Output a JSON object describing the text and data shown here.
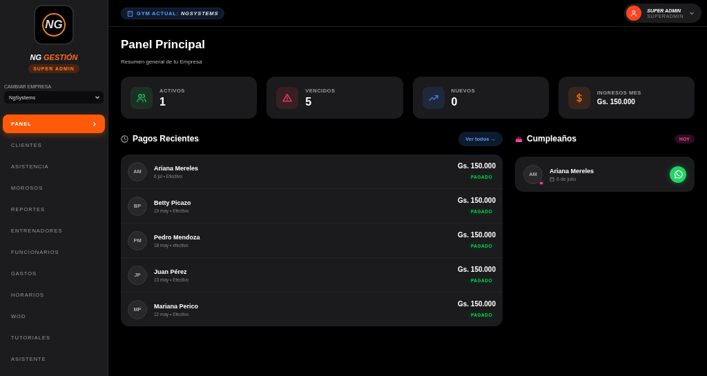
{
  "sidebar": {
    "logo_text": "NG",
    "brand": {
      "first": "NG",
      "second": "GESTIÓN"
    },
    "role_badge": "SUPER ADMIN",
    "company_label": "CAMBIAR EMPRESA",
    "company_value": "NgSystems",
    "items": [
      {
        "label": "PANEL",
        "selected": true
      },
      {
        "label": "CLIENTES",
        "selected": false
      },
      {
        "label": "ASISTENCIA",
        "selected": false
      },
      {
        "label": "MOROSOS",
        "selected": false
      },
      {
        "label": "REPORTES",
        "selected": false
      },
      {
        "label": "ENTRENADORES",
        "selected": false
      },
      {
        "label": "FUNCIONARIOS",
        "selected": false
      },
      {
        "label": "GASTOS",
        "selected": false
      },
      {
        "label": "HORARIOS",
        "selected": false
      },
      {
        "label": "WOD",
        "selected": false
      },
      {
        "label": "TUTORIALES",
        "selected": false
      },
      {
        "label": "ASISTENTE",
        "selected": false
      }
    ]
  },
  "topbar": {
    "gym_label": "GYM ACTUAL:",
    "gym_name": "NGSYSTEMS",
    "user_name": "SUPER ADMIN",
    "user_role": "SUPERADMIN"
  },
  "page": {
    "title": "Panel Principal",
    "subtitle": "Resumen general de tu Empresa"
  },
  "stats": [
    {
      "kind": "users",
      "label": "ACTIVOS",
      "value": "1",
      "color": "#22c55e"
    },
    {
      "kind": "alert",
      "label": "VENCIDOS",
      "value": "5",
      "color": "#f43f5e"
    },
    {
      "kind": "trend",
      "label": "NUEVOS",
      "value": "0",
      "color": "#3b82f6"
    },
    {
      "kind": "dollar",
      "label": "INGRESOS MES",
      "value": "Gs. 150.000",
      "color": "#f97316"
    }
  ],
  "payments": {
    "title": "Pagos Recientes",
    "link": "Ver todos →",
    "rows": [
      {
        "initials": "AM",
        "name": "Ariana Mereles",
        "meta": "6 jul • Efectivo",
        "amount": "Gs. 150.000",
        "status": "PAGADO"
      },
      {
        "initials": "BP",
        "name": "Betty Picazo",
        "meta": "19 may • Efectivo",
        "amount": "Gs. 150.000",
        "status": "PAGADO"
      },
      {
        "initials": "PM",
        "name": "Pedro Mendoza",
        "meta": "18 may • efectivo",
        "amount": "Gs. 150.000",
        "status": "PAGADO"
      },
      {
        "initials": "JP",
        "name": "Juan Pérez",
        "meta": "13 may • Efectivo",
        "amount": "Gs. 150.000",
        "status": "PAGADO"
      },
      {
        "initials": "MP",
        "name": "Mariana Perico",
        "meta": "12 may • Efectivo",
        "amount": "Gs. 150.000",
        "status": "PAGADO"
      }
    ]
  },
  "birthdays": {
    "title": "Cumpleaños",
    "badge": "HOY",
    "rows": [
      {
        "initials": "AM",
        "name": "Ariana Mereles",
        "date": "6 de julio"
      }
    ]
  }
}
